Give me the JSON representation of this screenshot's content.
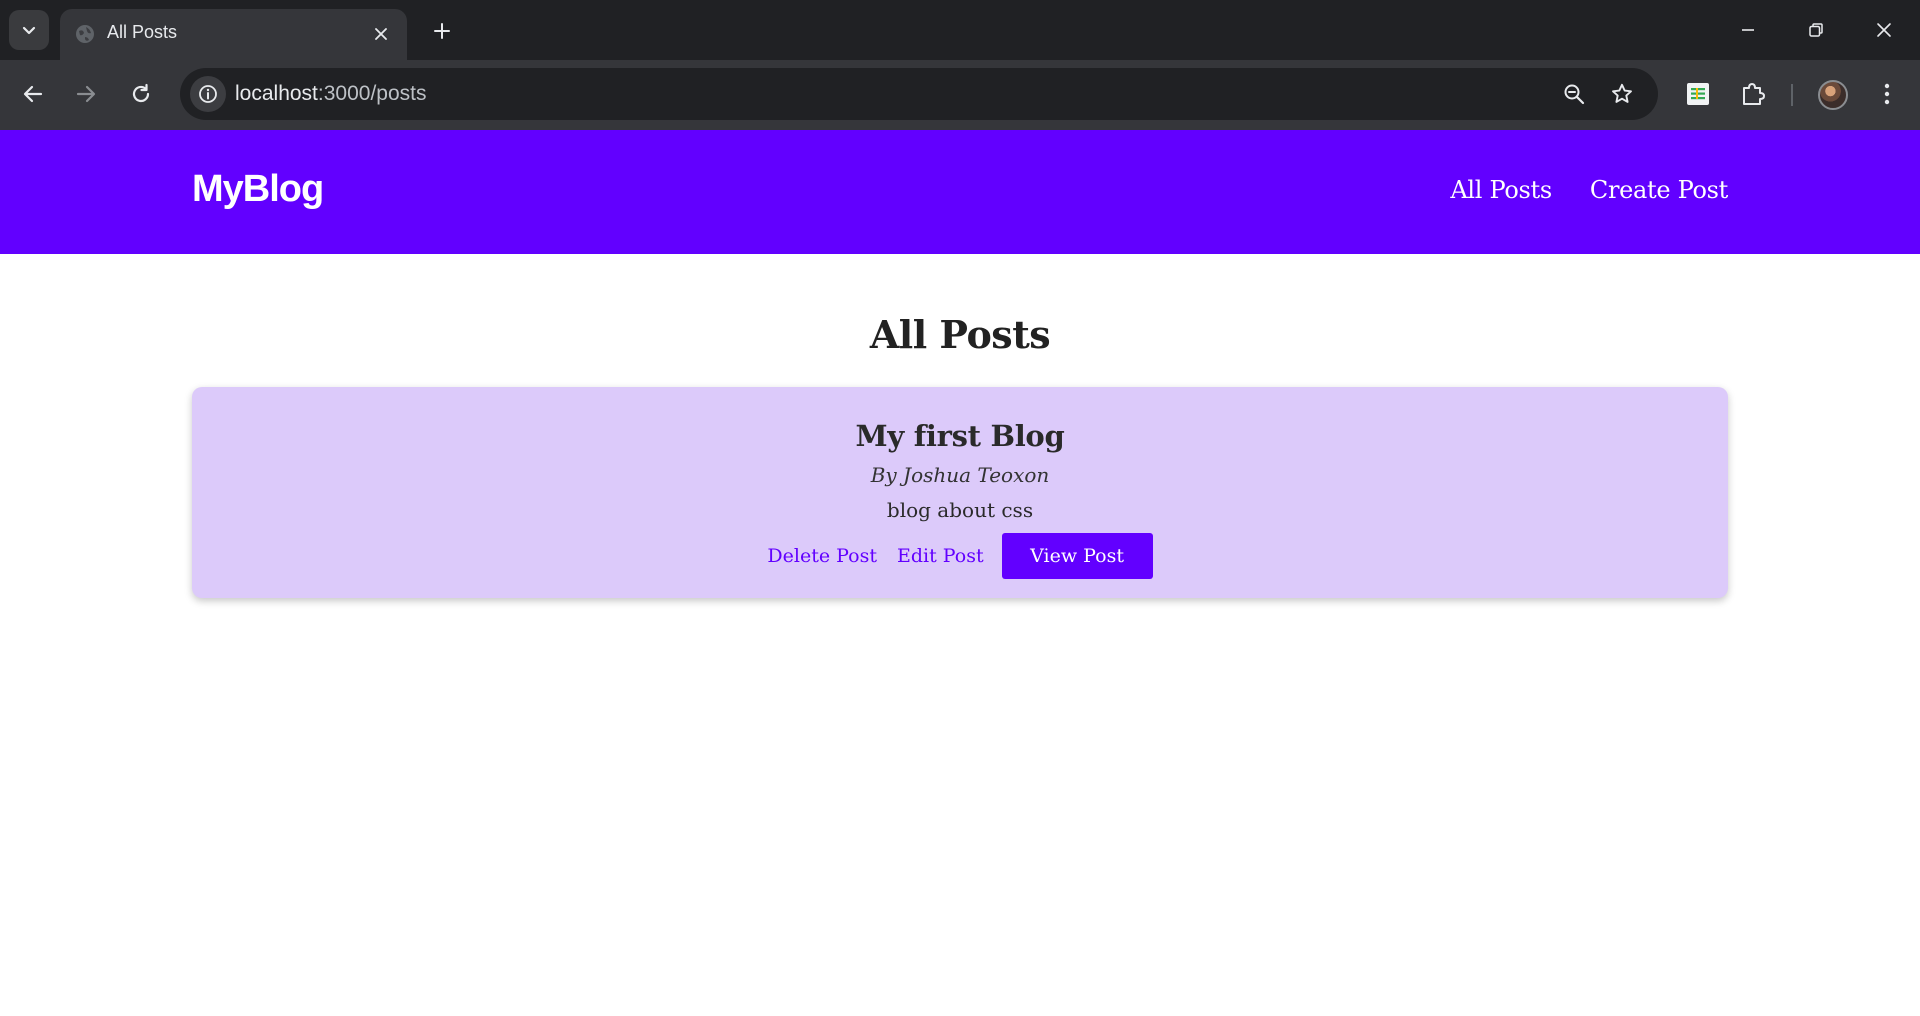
{
  "browser": {
    "tab_title": "All Posts",
    "url_host": "localhost",
    "url_path": ":3000/posts",
    "icons": {
      "tab_menu": "chevron-down-icon",
      "favicon": "globe-icon",
      "tab_close": "close-icon",
      "new_tab": "plus-icon",
      "minimize": "minimize-icon",
      "restore": "restore-icon",
      "close_window": "close-icon",
      "back": "arrow-left-icon",
      "forward": "arrow-right-icon",
      "reload": "reload-icon",
      "site_info": "info-icon",
      "zoom": "zoom-out-icon",
      "bookmark": "star-icon",
      "sheets_extension": "sheets-icon",
      "extensions": "puzzle-icon",
      "profile": "avatar",
      "menu": "more-vertical-icon"
    }
  },
  "site": {
    "logo": "MyBlog",
    "nav": [
      "All Posts",
      "Create Post"
    ],
    "brand_color": "#6200ff"
  },
  "page": {
    "title": "All Posts"
  },
  "posts": [
    {
      "title": "My first Blog",
      "author": "By Joshua Teoxon",
      "description": "blog about css",
      "delete_label": "Delete Post",
      "edit_label": "Edit Post",
      "view_label": "View Post",
      "card_color": "#dccafa"
    }
  ]
}
